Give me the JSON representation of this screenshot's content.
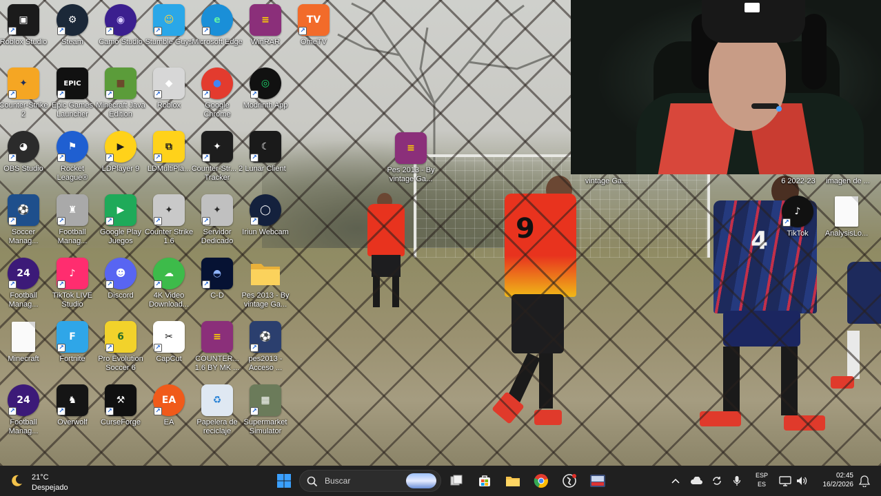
{
  "desktop": {
    "icons": [
      {
        "label": "Roblox Studio",
        "icon": "roblox-studio-icon",
        "glyph": "▣",
        "bg": "#1b1b1b",
        "fg": "#ffffff",
        "shortcut": true,
        "shape": "square",
        "col": 0,
        "row": 0
      },
      {
        "label": "Steam",
        "icon": "steam-icon",
        "glyph": "⚙",
        "bg": "#1b2838",
        "fg": "#ffffff",
        "shortcut": true,
        "shape": "round",
        "col": 1,
        "row": 0
      },
      {
        "label": "Camo Studio",
        "icon": "camo-studio-icon",
        "glyph": "◉",
        "bg": "#3b1f8f",
        "fg": "#d8ccff",
        "shortcut": true,
        "shape": "round",
        "col": 2,
        "row": 0
      },
      {
        "label": "Stumble Guys",
        "icon": "stumble-guys-icon",
        "glyph": "☺",
        "bg": "#2aa7e8",
        "fg": "#ffd23f",
        "shortcut": true,
        "shape": "square",
        "col": 3,
        "row": 0
      },
      {
        "label": "Microsoft Edge",
        "icon": "edge-icon",
        "glyph": "e",
        "bg": "#1a8fd8",
        "fg": "#5ff0a8",
        "shortcut": true,
        "shape": "round",
        "col": 4,
        "row": 0
      },
      {
        "label": "WinRAR",
        "icon": "winrar-icon",
        "glyph": "≡",
        "bg": "#8b2f7a",
        "fg": "#ffd400",
        "shortcut": false,
        "shape": "square",
        "col": 5,
        "row": 0
      },
      {
        "label": "OmeTV",
        "icon": "ometv-icon",
        "glyph": "TV",
        "bg": "#f26b2a",
        "fg": "#ffffff",
        "shortcut": true,
        "shape": "square",
        "col": 6,
        "row": 0
      },
      {
        "label": "Counter-Strike 2",
        "icon": "counter-strike-icon",
        "glyph": "✦",
        "bg": "#f5a623",
        "fg": "#1e2f5a",
        "shortcut": true,
        "shape": "square",
        "col": 0,
        "row": 1
      },
      {
        "label": "Epic Games Launcher",
        "icon": "epic-games-icon",
        "glyph": "EPIC",
        "bg": "#111111",
        "fg": "#ffffff",
        "shortcut": true,
        "shape": "square",
        "col": 1,
        "row": 1
      },
      {
        "label": "Minecraft Java Edition",
        "icon": "minecraft-icon",
        "glyph": "■",
        "bg": "#5b9c3a",
        "fg": "#6b4a2b",
        "shortcut": true,
        "shape": "square",
        "col": 2,
        "row": 1
      },
      {
        "label": "Roblox",
        "icon": "roblox-icon",
        "glyph": "◆",
        "bg": "#d7d7d7",
        "fg": "#ffffff",
        "shortcut": true,
        "shape": "square",
        "col": 3,
        "row": 1
      },
      {
        "label": "Google Chrome",
        "icon": "chrome-icon",
        "glyph": "●",
        "bg": "#e33b2e",
        "fg": "#4285f4",
        "shortcut": true,
        "shape": "round",
        "col": 4,
        "row": 1
      },
      {
        "label": "Modrinth App",
        "icon": "modrinth-icon",
        "glyph": "◎",
        "bg": "#111111",
        "fg": "#1bd96a",
        "shortcut": true,
        "shape": "round",
        "col": 5,
        "row": 1
      },
      {
        "label": "OBS Studio",
        "icon": "obs-icon",
        "glyph": "◕",
        "bg": "#2b2b2b",
        "fg": "#ffffff",
        "shortcut": true,
        "shape": "round",
        "col": 0,
        "row": 2
      },
      {
        "label": "Rocket League®",
        "icon": "rocket-league-icon",
        "glyph": "⚑",
        "bg": "#1f5fd1",
        "fg": "#ffffff",
        "shortcut": true,
        "shape": "round",
        "col": 1,
        "row": 2
      },
      {
        "label": "LDPlayer 9",
        "icon": "ldplayer-icon",
        "glyph": "▶",
        "bg": "#ffd21a",
        "fg": "#1b1b1b",
        "shortcut": true,
        "shape": "round",
        "col": 2,
        "row": 2
      },
      {
        "label": "LDMultiPla...",
        "icon": "ldmultiplayer-icon",
        "glyph": "⧉",
        "bg": "#ffd21a",
        "fg": "#1b1b1b",
        "shortcut": true,
        "shape": "square",
        "col": 3,
        "row": 2
      },
      {
        "label": "Counter-Str... 2 Tracker",
        "icon": "cs2-tracker-icon",
        "glyph": "✦",
        "bg": "#1d1d1d",
        "fg": "#ffffff",
        "shortcut": true,
        "shape": "square",
        "col": 4,
        "row": 2
      },
      {
        "label": "Lunar Client",
        "icon": "lunar-client-icon",
        "glyph": "☾",
        "bg": "#1a1a1a",
        "fg": "#ffffff",
        "shortcut": true,
        "shape": "square",
        "col": 5,
        "row": 2
      },
      {
        "label": "Soccer Manag...",
        "icon": "soccer-manager-icon",
        "glyph": "⚽",
        "bg": "#1e4f8c",
        "fg": "#ffffff",
        "shortcut": true,
        "shape": "square",
        "col": 0,
        "row": 3
      },
      {
        "label": "Football Manag...",
        "icon": "football-manager-bot-icon",
        "glyph": "♜",
        "bg": "#a9a9a9",
        "fg": "#ffffff",
        "shortcut": true,
        "shape": "square",
        "col": 1,
        "row": 3
      },
      {
        "label": "Google Play Juegos",
        "icon": "google-play-games-icon",
        "glyph": "▶",
        "bg": "#1faa59",
        "fg": "#ffffff",
        "shortcut": true,
        "shape": "square",
        "col": 2,
        "row": 3
      },
      {
        "label": "Counter Strike 1.6",
        "icon": "counter-strike-16-icon",
        "glyph": "✦",
        "bg": "#c9c9c9",
        "fg": "#2a2a2a",
        "shortcut": true,
        "shape": "square",
        "col": 3,
        "row": 3
      },
      {
        "label": "Servidor Dedicado",
        "icon": "dedicated-server-icon",
        "glyph": "✦",
        "bg": "#c0c0c0",
        "fg": "#2a2a2a",
        "shortcut": true,
        "shape": "square",
        "col": 4,
        "row": 3
      },
      {
        "label": "Iriun Webcam",
        "icon": "iriun-webcam-icon",
        "glyph": "◯",
        "bg": "#14213d",
        "fg": "#ffffff",
        "shortcut": true,
        "shape": "round",
        "col": 5,
        "row": 3
      },
      {
        "label": "Football Manag...",
        "icon": "football-manager-24-icon",
        "glyph": "24",
        "bg": "#3c1a78",
        "fg": "#ffffff",
        "shortcut": true,
        "shape": "round",
        "col": 0,
        "row": 4
      },
      {
        "label": "TikTok LIVE Studio",
        "icon": "tiktok-live-studio-icon",
        "glyph": "♪",
        "bg": "#ff2d6f",
        "fg": "#ffffff",
        "shortcut": true,
        "shape": "square",
        "col": 1,
        "row": 4
      },
      {
        "label": "Discord",
        "icon": "discord-icon",
        "glyph": "☻",
        "bg": "#5865f2",
        "fg": "#ffffff",
        "shortcut": true,
        "shape": "round",
        "col": 2,
        "row": 4
      },
      {
        "label": "4K Video Download...",
        "icon": "4k-video-downloader-icon",
        "glyph": "☁",
        "bg": "#3dbb4a",
        "fg": "#ffffff",
        "shortcut": true,
        "shape": "round",
        "col": 3,
        "row": 4
      },
      {
        "label": "C-D",
        "icon": "c-d-icon",
        "glyph": "◓",
        "bg": "#061233",
        "fg": "#8fb4ff",
        "shortcut": true,
        "shape": "square",
        "col": 4,
        "row": 4
      },
      {
        "label": "Pes 2013 - By vintage Ga...",
        "icon": "folder-icon",
        "glyph": "",
        "bg": "#f4c542",
        "fg": "#ffffff",
        "shortcut": false,
        "shape": "folder",
        "col": 5,
        "row": 4
      },
      {
        "label": "Minecraft",
        "icon": "minecraft-file-icon",
        "glyph": "",
        "bg": "#ffffff",
        "fg": "#ffffff",
        "shortcut": false,
        "shape": "file",
        "col": 0,
        "row": 5
      },
      {
        "label": "Fortnite",
        "icon": "fortnite-icon",
        "glyph": "F",
        "bg": "#2fa6e8",
        "fg": "#ffffff",
        "shortcut": true,
        "shape": "square",
        "col": 1,
        "row": 5
      },
      {
        "label": "Pro Evolution Soccer 6",
        "icon": "pes6-icon",
        "glyph": "6",
        "bg": "#f2d22b",
        "fg": "#2a6d2a",
        "shortcut": true,
        "shape": "square",
        "col": 2,
        "row": 5
      },
      {
        "label": "CapCut",
        "icon": "capcut-icon",
        "glyph": "✂",
        "bg": "#ffffff",
        "fg": "#111111",
        "shortcut": true,
        "shape": "square",
        "col": 3,
        "row": 5
      },
      {
        "label": "COUNTER... 1.6 BY MK ...",
        "icon": "winrar-archive-icon",
        "glyph": "≡",
        "bg": "#8b2f7a",
        "fg": "#ffd400",
        "shortcut": false,
        "shape": "square",
        "col": 4,
        "row": 5
      },
      {
        "label": "pes2013 - Acceso ...",
        "icon": "pes2013-shortcut-icon",
        "glyph": "⚽",
        "bg": "#2b3f6e",
        "fg": "#ffffff",
        "shortcut": true,
        "shape": "square",
        "col": 5,
        "row": 5
      },
      {
        "label": "Football Manag...",
        "icon": "football-manager-24b-icon",
        "glyph": "24",
        "bg": "#3c1a78",
        "fg": "#ffffff",
        "shortcut": true,
        "shape": "round",
        "col": 0,
        "row": 6
      },
      {
        "label": "Overwolf",
        "icon": "overwolf-icon",
        "glyph": "♞",
        "bg": "#151515",
        "fg": "#ffffff",
        "shortcut": true,
        "shape": "square",
        "col": 1,
        "row": 6
      },
      {
        "label": "CurseForge",
        "icon": "curseforge-icon",
        "glyph": "⚒",
        "bg": "#101010",
        "fg": "#ffffff",
        "shortcut": true,
        "shape": "square",
        "col": 2,
        "row": 6
      },
      {
        "label": "EA",
        "icon": "ea-icon",
        "glyph": "EA",
        "bg": "#f05a1a",
        "fg": "#ffffff",
        "shortcut": true,
        "shape": "round",
        "col": 3,
        "row": 6
      },
      {
        "label": "Papelera de reciclaje",
        "icon": "recycle-bin-icon",
        "glyph": "♻",
        "bg": "#dfe8f2",
        "fg": "#2a83d6",
        "shortcut": false,
        "shape": "square",
        "col": 4,
        "row": 6
      },
      {
        "label": "Supermarket Simulator",
        "icon": "supermarket-simulator-icon",
        "glyph": "▦",
        "bg": "#6b7b5a",
        "fg": "#ffffff",
        "shortcut": true,
        "shape": "square",
        "col": 5,
        "row": 6
      }
    ],
    "loose_icons": [
      {
        "id": "pes-archive",
        "label": "Pes 2013 - By vintage Ga...",
        "icon": "winrar-archive-icon",
        "glyph": "≡",
        "bg": "#8b2f7a",
        "fg": "#ffd400",
        "shortcut": false,
        "shape": "square"
      },
      {
        "id": "tiktok",
        "label": "TikTok",
        "icon": "tiktok-icon",
        "glyph": "♪",
        "bg": "#111111",
        "fg": "#ffffff",
        "shortcut": true,
        "shape": "round"
      },
      {
        "id": "analysis-file",
        "label": "AnalysisLo...",
        "icon": "file-icon",
        "glyph": "",
        "bg": "#ffffff",
        "fg": "#ffffff",
        "shortcut": false,
        "shape": "file"
      }
    ],
    "partial_labels": {
      "vintage": "vintage Ga...",
      "season": "6 2022-23",
      "image": "imagen de ..."
    }
  },
  "webcam": {
    "cap_logo": "MLB"
  },
  "player_number": "9",
  "player_number_2": "4",
  "taskbar": {
    "weather": {
      "temperature": "21°C",
      "description": "Despejado",
      "icon": "moon-icon"
    },
    "search_placeholder": "Buscar",
    "pinned": [
      {
        "name": "start-button",
        "icon": "windows-start-icon"
      },
      {
        "name": "task-view-button",
        "icon": "task-view-icon"
      },
      {
        "name": "store-button",
        "icon": "microsoft-store-icon"
      },
      {
        "name": "file-explorer-button",
        "icon": "folder-icon"
      },
      {
        "name": "chrome-taskbar-button",
        "icon": "chrome-icon"
      },
      {
        "name": "cs2-taskbar-button",
        "icon": "counter-strike-icon"
      },
      {
        "name": "pes-taskbar-button",
        "icon": "pes-icon"
      }
    ],
    "language": {
      "line1": "ESP",
      "line2": "ES"
    },
    "clock": {
      "time": "02:45",
      "date": "16/2/2026"
    }
  }
}
